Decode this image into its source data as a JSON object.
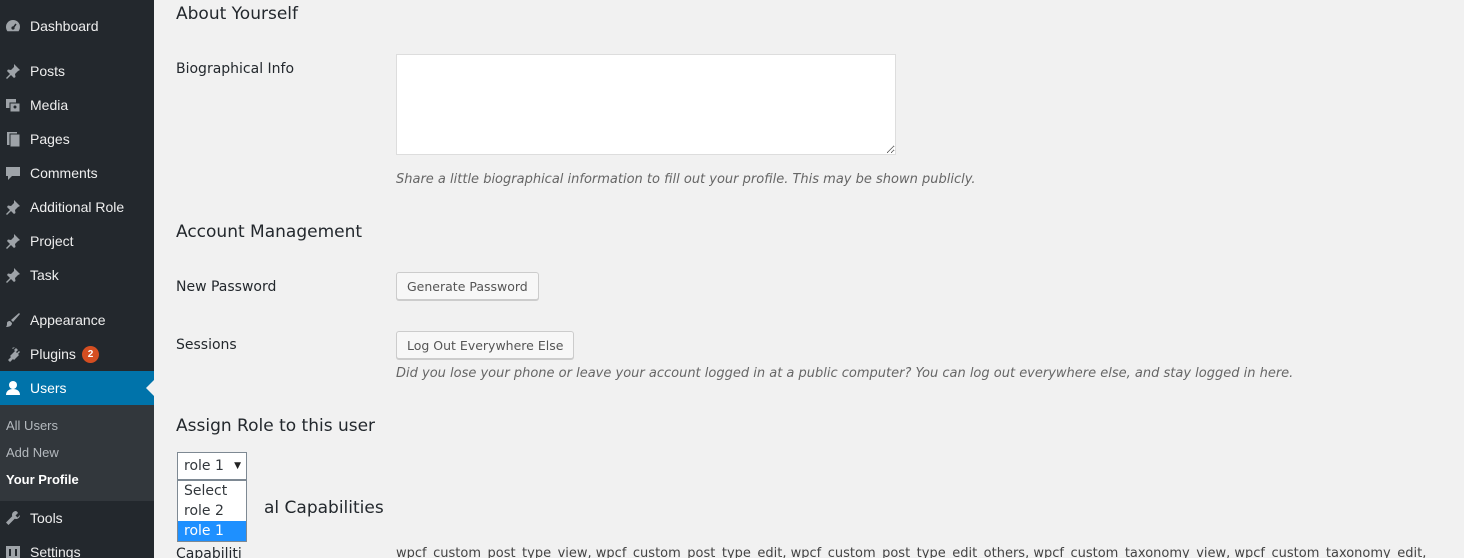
{
  "sidebar": {
    "items": [
      {
        "label": "Dashboard",
        "icon": "dashboard-icon"
      },
      {
        "label": "Posts",
        "icon": "pin-icon"
      },
      {
        "label": "Media",
        "icon": "media-icon"
      },
      {
        "label": "Pages",
        "icon": "pages-icon"
      },
      {
        "label": "Comments",
        "icon": "comment-icon"
      },
      {
        "label": "Additional Role",
        "icon": "pin-icon"
      },
      {
        "label": "Project",
        "icon": "pin-icon"
      },
      {
        "label": "Task",
        "icon": "pin-icon"
      },
      {
        "label": "Appearance",
        "icon": "brush-icon"
      },
      {
        "label": "Plugins",
        "icon": "plugin-icon",
        "badge": "2"
      },
      {
        "label": "Users",
        "icon": "user-icon",
        "active": true
      },
      {
        "label": "Tools",
        "icon": "wrench-icon"
      },
      {
        "label": "Settings",
        "icon": "settings-icon"
      }
    ],
    "submenu": [
      "All Users",
      "Add New",
      "Your Profile"
    ],
    "colors": {
      "background": "#23282d",
      "active": "#0073aa",
      "submenu": "#32373c",
      "badge": "#d54e21"
    }
  },
  "about": {
    "title": "About Yourself",
    "bio_label": "Biographical Info",
    "bio_value": "",
    "bio_desc": "Share a little biographical information to fill out your profile. This may be shown publicly."
  },
  "account": {
    "title": "Account Management",
    "password_label": "New Password",
    "generate_button": "Generate Password",
    "sessions_label": "Sessions",
    "logout_button": "Log Out Everywhere Else",
    "sessions_desc": "Did you lose your phone or leave your account logged in at a public computer? You can log out everywhere else, and stay logged in here."
  },
  "role": {
    "title": "Assign Role to this user",
    "selected": "role 1",
    "options": [
      "Select",
      "role 2",
      "role 1"
    ]
  },
  "capabilities": {
    "title_visible": "al Capabilities",
    "label_visible": "Capabiliti",
    "text": "wpcf_custom_post_type_view, wpcf_custom_post_type_edit, wpcf_custom_post_type_edit_others, wpcf_custom_taxonomy_view, wpcf_custom_taxonomy_edit,"
  }
}
